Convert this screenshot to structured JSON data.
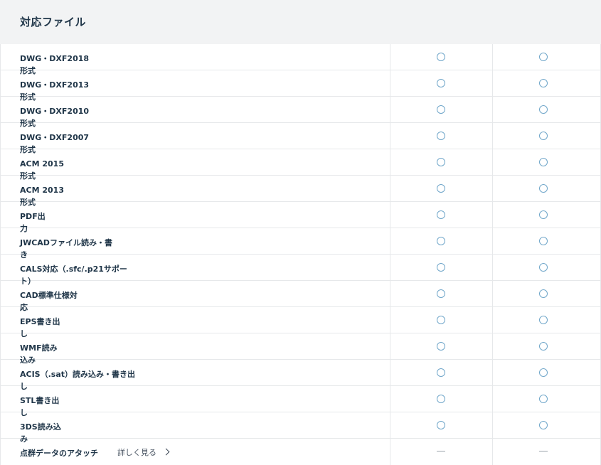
{
  "header": {
    "title": "対応ファイル"
  },
  "rows": [
    {
      "label": "DWG・DXF2018形式"
    },
    {
      "label": "DWG・DXF2013形式"
    },
    {
      "label": "DWG・DXF2010形式"
    },
    {
      "label": "DWG・DXF2007形式"
    },
    {
      "label": "ACM 2015形式"
    },
    {
      "label": "ACM 2013形式"
    },
    {
      "label": "PDF出力"
    },
    {
      "label": "JWCADファイル読み・書き"
    },
    {
      "label": "CALS対応（.sfc/.p21サポート）"
    },
    {
      "label": "CAD標準仕様対応"
    },
    {
      "label": "EPS書き出し"
    },
    {
      "label": "WMF読み込み"
    },
    {
      "label": "ACIS（.sat）読み込み・書き出し"
    },
    {
      "label": "STL書き出し"
    },
    {
      "label": "3DS読み込み"
    },
    {
      "label": "点群データのアタッチ",
      "link": "詳しく見る"
    }
  ],
  "marks": {
    "supported": "circle-outline",
    "unsupported": "dash"
  },
  "colors": {
    "accent": "#6fa6c9",
    "header_bg": "#f2f3f4",
    "text": "#1f3548"
  }
}
